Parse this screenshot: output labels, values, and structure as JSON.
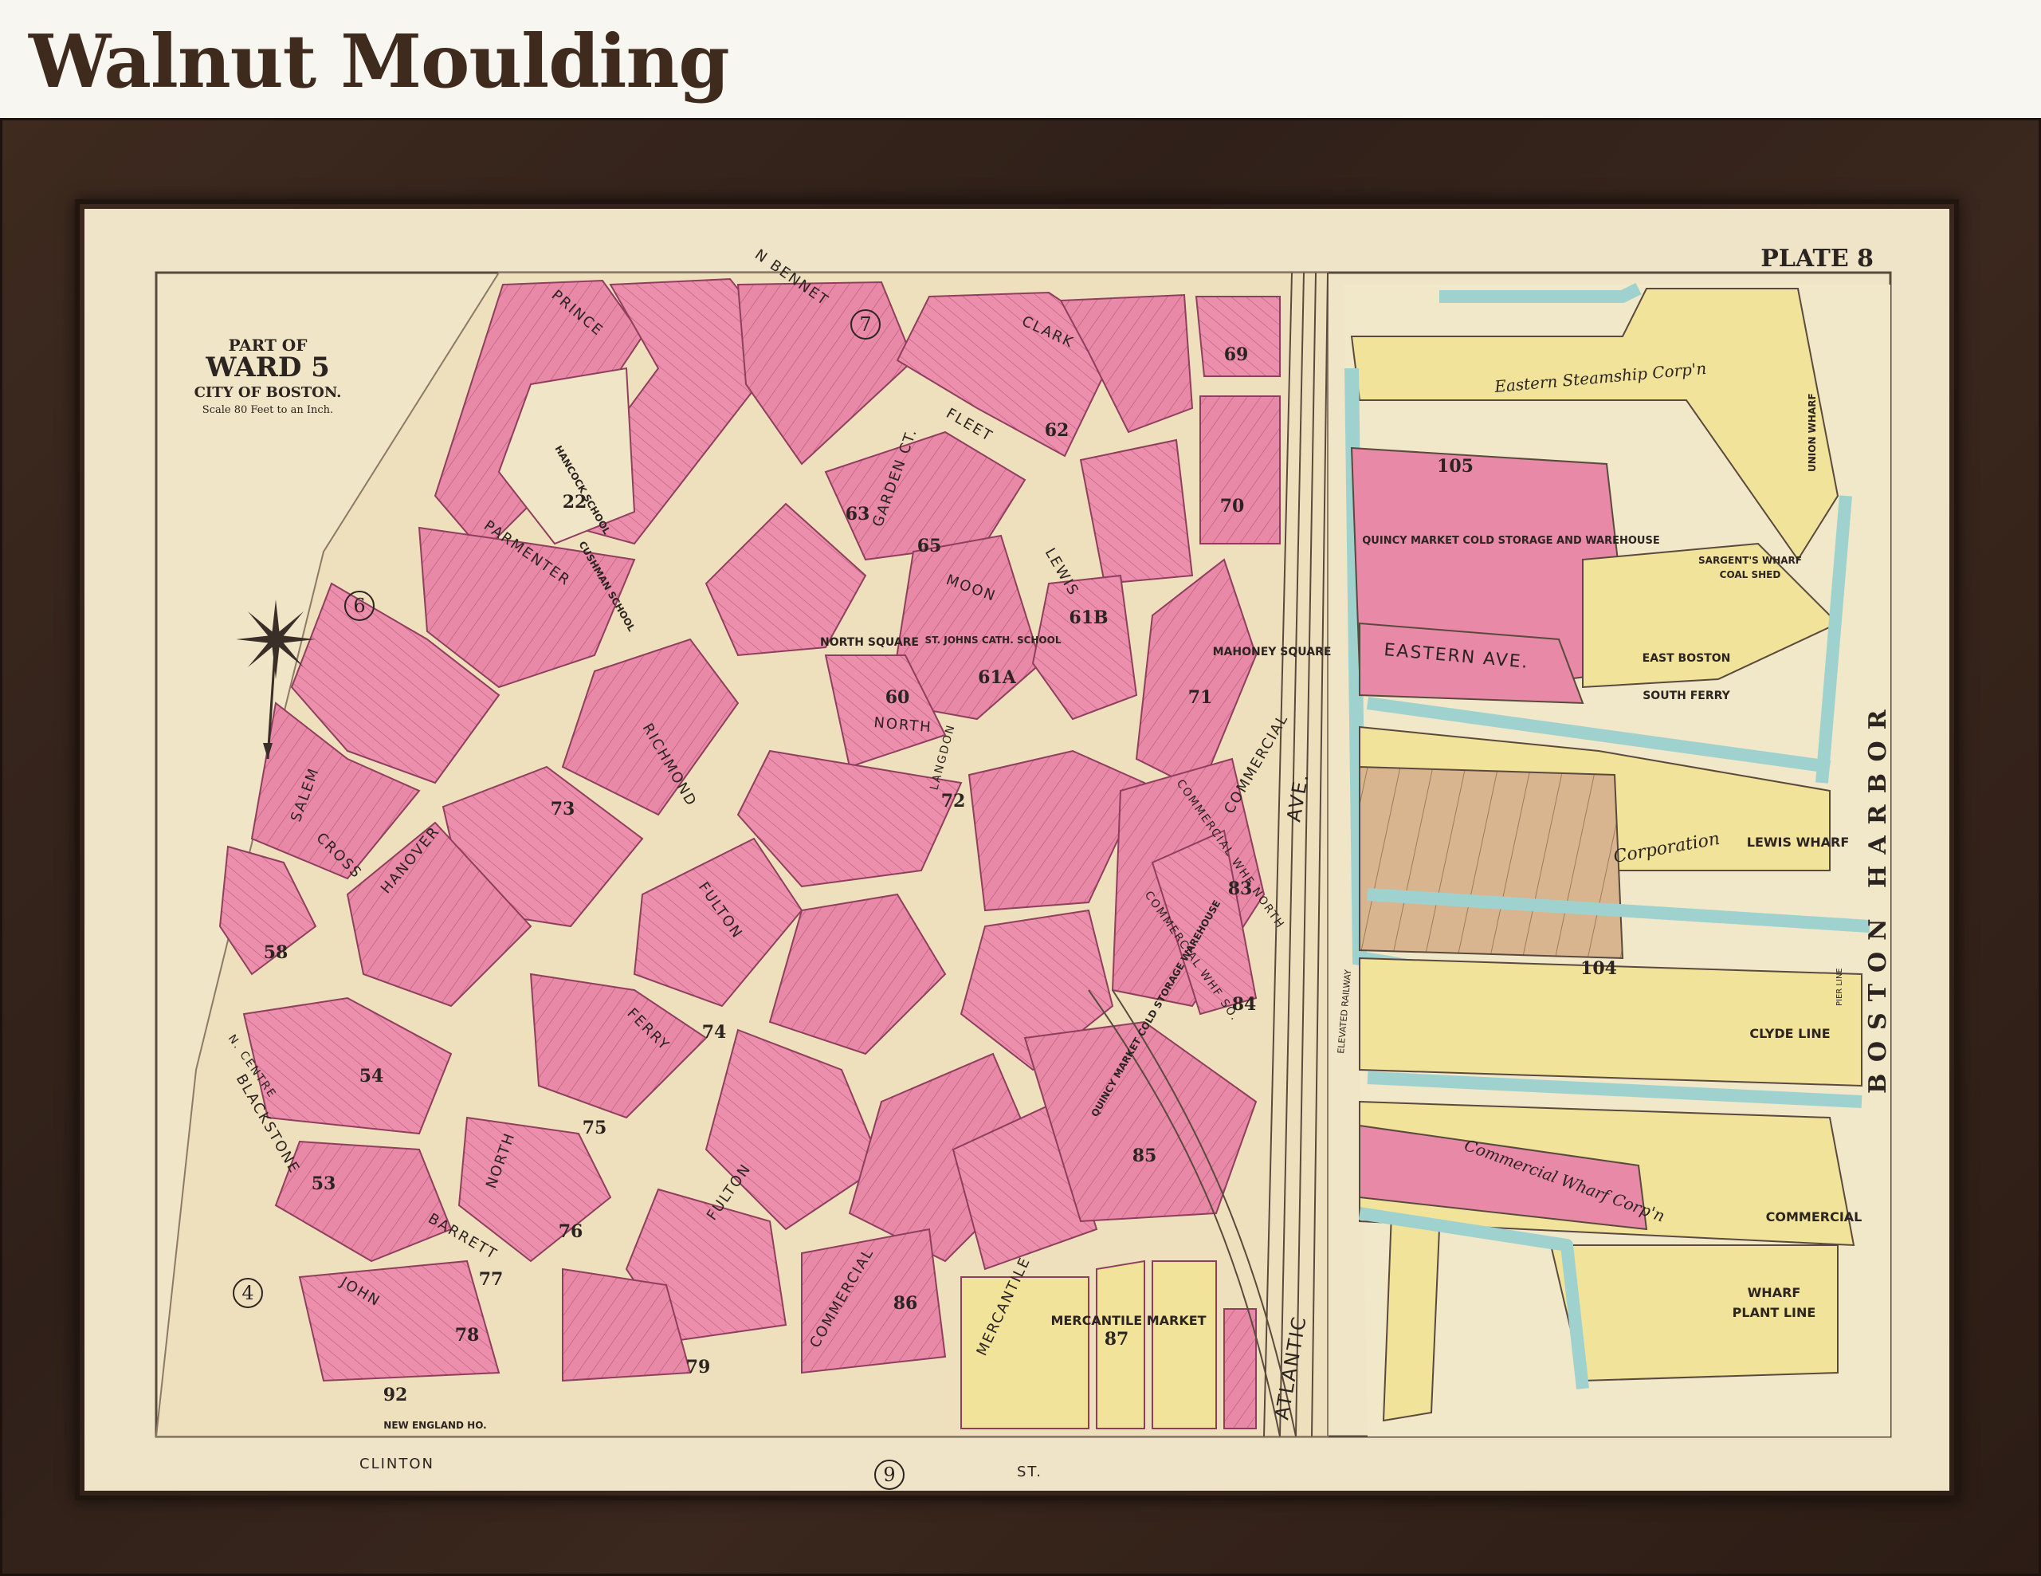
{
  "header": {
    "title": "Walnut Moulding"
  },
  "map": {
    "plate": "PLATE 8",
    "title_block": {
      "line1": "PART OF",
      "line2": "WARD 5",
      "line3": "CITY OF BOSTON.",
      "scale": "Scale 80 Feet to an Inch."
    },
    "ward_numbers": {
      "w7": "7",
      "w6": "6",
      "w4": "4",
      "w9": "9"
    },
    "streets": {
      "prince": "PRINCE",
      "bennet": "N BENNET",
      "clark": "CLARK",
      "fleet": "FLEET",
      "garden": "GARDEN CT.",
      "moon": "MOON",
      "lewis": "LEWIS",
      "parmenter": "PARMENTER",
      "salem": "SALEM",
      "richmond": "RICHMOND",
      "hanover": "HANOVER",
      "cross": "CROSS",
      "north": "NORTH",
      "north_lower": "NORTH",
      "fulton": "FULTON",
      "fulton_lower": "FULTON",
      "ferry": "FERRY",
      "commercial": "COMMERCIAL",
      "commercial_lower": "COMMERCIAL",
      "eastern_ave": "EASTERN AVE.",
      "atlantic": "ATLANTIC",
      "ave": "AVE.",
      "blackstone": "BLACKSTONE",
      "n_centre": "N. CENTRE",
      "barrett": "BARRETT",
      "john": "JOHN",
      "clinton": "CLINTON",
      "mercantile": "MERCANTILE",
      "commercial_whf_no": "COMMERCIAL WHF NORTH",
      "commercial_whf_so": "COMMERCIAL WHF SO.",
      "langdon": "LANGDON",
      "st": "ST."
    },
    "places": {
      "north_square": "NORTH SQUARE",
      "mahoney_square": "MAHONEY SQUARE",
      "st_johns": "ST. JOHNS CATH. SCHOOL",
      "hancock_school": "HANCOCK SCHOOL",
      "cushman_school": "CUSHMAN SCHOOL",
      "quincy_market": "QUINCY MARKET COLD STORAGE AND WAREHOUSE",
      "quincy_market_2": "QUINCY MARKET COLD STORAGE WAREHOUSE",
      "mercantile_market": "MERCANTILE MARKET",
      "new_england_ho": "NEW ENGLAND HO.",
      "east_boston": "EAST BOSTON",
      "south_ferry": "SOUTH FERRY",
      "sargents_wharf": "SARGENT'S WHARF",
      "coal_shed": "COAL SHED",
      "union_wharf": "UNION WHARF",
      "lewis_wharf": "LEWIS WHARF",
      "clyde_line": "CLYDE LINE",
      "commercial_wharf": "COMMERCIAL",
      "wharf_plant_line": "WHARF",
      "plant_line": "PLANT LINE",
      "boston_harbor": "BOSTON HARBOR",
      "pier_line": "PIER LINE",
      "eastern_steamship": "Eastern Steamship Corp'n",
      "lewis_wharf_corp": "Corporation",
      "commercial_wharf_corp": "Commercial Wharf Corp'n",
      "elevated_railway": "ELEVATED RAILWAY"
    },
    "lot_numbers": {
      "p69": "69",
      "p62": "62",
      "p70": "70",
      "p105": "105",
      "p22": "22",
      "p63": "63",
      "p65": "65",
      "p60": "60",
      "p61a": "61A",
      "p61b": "61B",
      "p72": "72",
      "p71": "71",
      "p83": "83",
      "p84": "84",
      "p85": "85",
      "p87": "87",
      "p104": "104",
      "p73": "73",
      "p74": "74",
      "p75": "75",
      "p76": "76",
      "p77": "77",
      "p78": "78",
      "p79": "79",
      "p86": "86",
      "p92": "92",
      "p53": "53",
      "p54": "54",
      "p58": "58"
    },
    "colors": {
      "paper": "#efe4c8",
      "brick_pink": "#e889a8",
      "wood_yellow": "#f1e39a",
      "water_blue": "#9fd2cf",
      "stone_tan": "#d9b58f",
      "ink": "#3a2e28",
      "frame": "#3a271d"
    }
  }
}
